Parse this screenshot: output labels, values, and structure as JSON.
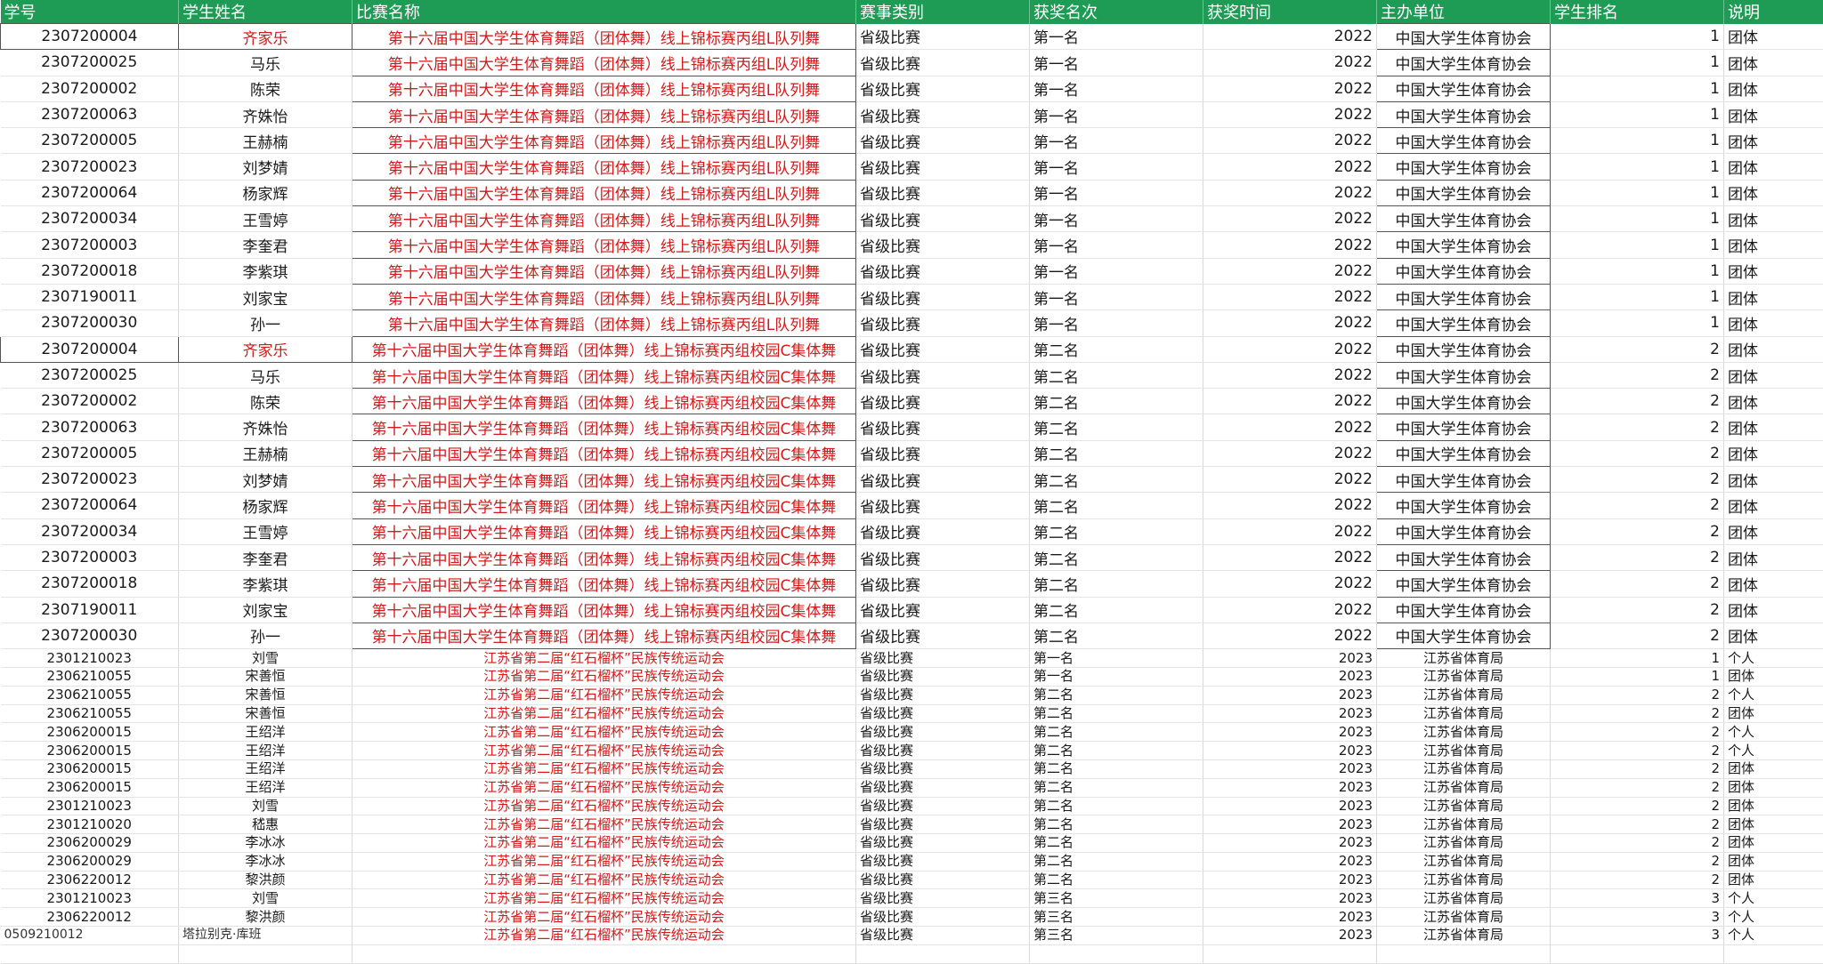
{
  "columns": [
    "学号",
    "学生姓名",
    "比赛名称",
    "赛事类别",
    "获奖名次",
    "获奖时间",
    "主办单位",
    "学生排名",
    "说明"
  ],
  "rows": [
    {
      "id": "2307200004",
      "name": "齐家乐",
      "name_red": true,
      "comp": "第十六届中国大学生体育舞蹈（团体舞）线上锦标赛丙组L队列舞",
      "cat": "省级比赛",
      "rank": "第一名",
      "year": "2022",
      "org": "中国大学生体育协会",
      "srank": "1",
      "note": "团体",
      "size": "big",
      "boxed": true
    },
    {
      "id": "2307200025",
      "name": "马乐",
      "comp": "第十六届中国大学生体育舞蹈（团体舞）线上锦标赛丙组L队列舞",
      "cat": "省级比赛",
      "rank": "第一名",
      "year": "2022",
      "org": "中国大学生体育协会",
      "srank": "1",
      "note": "团体",
      "size": "big"
    },
    {
      "id": "2307200002",
      "name": "陈荣",
      "comp": "第十六届中国大学生体育舞蹈（团体舞）线上锦标赛丙组L队列舞",
      "cat": "省级比赛",
      "rank": "第一名",
      "year": "2022",
      "org": "中国大学生体育协会",
      "srank": "1",
      "note": "团体",
      "size": "big"
    },
    {
      "id": "2307200063",
      "name": "齐姝怡",
      "comp": "第十六届中国大学生体育舞蹈（团体舞）线上锦标赛丙组L队列舞",
      "cat": "省级比赛",
      "rank": "第一名",
      "year": "2022",
      "org": "中国大学生体育协会",
      "srank": "1",
      "note": "团体",
      "size": "big"
    },
    {
      "id": "2307200005",
      "name": "王赫楠",
      "comp": "第十六届中国大学生体育舞蹈（团体舞）线上锦标赛丙组L队列舞",
      "cat": "省级比赛",
      "rank": "第一名",
      "year": "2022",
      "org": "中国大学生体育协会",
      "srank": "1",
      "note": "团体",
      "size": "big"
    },
    {
      "id": "2307200023",
      "name": "刘梦婧",
      "comp": "第十六届中国大学生体育舞蹈（团体舞）线上锦标赛丙组L队列舞",
      "cat": "省级比赛",
      "rank": "第一名",
      "year": "2022",
      "org": "中国大学生体育协会",
      "srank": "1",
      "note": "团体",
      "size": "big"
    },
    {
      "id": "2307200064",
      "name": "杨家辉",
      "comp": "第十六届中国大学生体育舞蹈（团体舞）线上锦标赛丙组L队列舞",
      "cat": "省级比赛",
      "rank": "第一名",
      "year": "2022",
      "org": "中国大学生体育协会",
      "srank": "1",
      "note": "团体",
      "size": "big"
    },
    {
      "id": "2307200034",
      "name": "王雪婷",
      "comp": "第十六届中国大学生体育舞蹈（团体舞）线上锦标赛丙组L队列舞",
      "cat": "省级比赛",
      "rank": "第一名",
      "year": "2022",
      "org": "中国大学生体育协会",
      "srank": "1",
      "note": "团体",
      "size": "big"
    },
    {
      "id": "2307200003",
      "name": "李奎君",
      "comp": "第十六届中国大学生体育舞蹈（团体舞）线上锦标赛丙组L队列舞",
      "cat": "省级比赛",
      "rank": "第一名",
      "year": "2022",
      "org": "中国大学生体育协会",
      "srank": "1",
      "note": "团体",
      "size": "big"
    },
    {
      "id": "2307200018",
      "name": "李紫琪",
      "comp": "第十六届中国大学生体育舞蹈（团体舞）线上锦标赛丙组L队列舞",
      "cat": "省级比赛",
      "rank": "第一名",
      "year": "2022",
      "org": "中国大学生体育协会",
      "srank": "1",
      "note": "团体",
      "size": "big"
    },
    {
      "id": "2307190011",
      "name": "刘家宝",
      "comp": "第十六届中国大学生体育舞蹈（团体舞）线上锦标赛丙组L队列舞",
      "cat": "省级比赛",
      "rank": "第一名",
      "year": "2022",
      "org": "中国大学生体育协会",
      "srank": "1",
      "note": "团体",
      "size": "big"
    },
    {
      "id": "2307200030",
      "name": "孙一",
      "comp": "第十六届中国大学生体育舞蹈（团体舞）线上锦标赛丙组L队列舞",
      "cat": "省级比赛",
      "rank": "第一名",
      "year": "2022",
      "org": "中国大学生体育协会",
      "srank": "1",
      "note": "团体",
      "size": "big"
    },
    {
      "id": "2307200004",
      "name": "齐家乐",
      "name_red": true,
      "comp": "第十六届中国大学生体育舞蹈（团体舞）线上锦标赛丙组校园C集体舞",
      "cat": "省级比赛",
      "rank": "第二名",
      "year": "2022",
      "org": "中国大学生体育协会",
      "srank": "2",
      "note": "团体",
      "size": "big",
      "boxed": true
    },
    {
      "id": "2307200025",
      "name": "马乐",
      "comp": "第十六届中国大学生体育舞蹈（团体舞）线上锦标赛丙组校园C集体舞",
      "cat": "省级比赛",
      "rank": "第二名",
      "year": "2022",
      "org": "中国大学生体育协会",
      "srank": "2",
      "note": "团体",
      "size": "big"
    },
    {
      "id": "2307200002",
      "name": "陈荣",
      "comp": "第十六届中国大学生体育舞蹈（团体舞）线上锦标赛丙组校园C集体舞",
      "cat": "省级比赛",
      "rank": "第二名",
      "year": "2022",
      "org": "中国大学生体育协会",
      "srank": "2",
      "note": "团体",
      "size": "big"
    },
    {
      "id": "2307200063",
      "name": "齐姝怡",
      "comp": "第十六届中国大学生体育舞蹈（团体舞）线上锦标赛丙组校园C集体舞",
      "cat": "省级比赛",
      "rank": "第二名",
      "year": "2022",
      "org": "中国大学生体育协会",
      "srank": "2",
      "note": "团体",
      "size": "big"
    },
    {
      "id": "2307200005",
      "name": "王赫楠",
      "comp": "第十六届中国大学生体育舞蹈（团体舞）线上锦标赛丙组校园C集体舞",
      "cat": "省级比赛",
      "rank": "第二名",
      "year": "2022",
      "org": "中国大学生体育协会",
      "srank": "2",
      "note": "团体",
      "size": "big"
    },
    {
      "id": "2307200023",
      "name": "刘梦婧",
      "comp": "第十六届中国大学生体育舞蹈（团体舞）线上锦标赛丙组校园C集体舞",
      "cat": "省级比赛",
      "rank": "第二名",
      "year": "2022",
      "org": "中国大学生体育协会",
      "srank": "2",
      "note": "团体",
      "size": "big"
    },
    {
      "id": "2307200064",
      "name": "杨家辉",
      "comp": "第十六届中国大学生体育舞蹈（团体舞）线上锦标赛丙组校园C集体舞",
      "cat": "省级比赛",
      "rank": "第二名",
      "year": "2022",
      "org": "中国大学生体育协会",
      "srank": "2",
      "note": "团体",
      "size": "big"
    },
    {
      "id": "2307200034",
      "name": "王雪婷",
      "comp": "第十六届中国大学生体育舞蹈（团体舞）线上锦标赛丙组校园C集体舞",
      "cat": "省级比赛",
      "rank": "第二名",
      "year": "2022",
      "org": "中国大学生体育协会",
      "srank": "2",
      "note": "团体",
      "size": "big"
    },
    {
      "id": "2307200003",
      "name": "李奎君",
      "comp": "第十六届中国大学生体育舞蹈（团体舞）线上锦标赛丙组校园C集体舞",
      "cat": "省级比赛",
      "rank": "第二名",
      "year": "2022",
      "org": "中国大学生体育协会",
      "srank": "2",
      "note": "团体",
      "size": "big"
    },
    {
      "id": "2307200018",
      "name": "李紫琪",
      "comp": "第十六届中国大学生体育舞蹈（团体舞）线上锦标赛丙组校园C集体舞",
      "cat": "省级比赛",
      "rank": "第二名",
      "year": "2022",
      "org": "中国大学生体育协会",
      "srank": "2",
      "note": "团体",
      "size": "big"
    },
    {
      "id": "2307190011",
      "name": "刘家宝",
      "comp": "第十六届中国大学生体育舞蹈（团体舞）线上锦标赛丙组校园C集体舞",
      "cat": "省级比赛",
      "rank": "第二名",
      "year": "2022",
      "org": "中国大学生体育协会",
      "srank": "2",
      "note": "团体",
      "size": "big"
    },
    {
      "id": "2307200030",
      "name": "孙一",
      "comp": "第十六届中国大学生体育舞蹈（团体舞）线上锦标赛丙组校园C集体舞",
      "cat": "省级比赛",
      "rank": "第二名",
      "year": "2022",
      "org": "中国大学生体育协会",
      "srank": "2",
      "note": "团体",
      "size": "big"
    },
    {
      "id": "2301210023",
      "name": "刘雪",
      "comp": "江苏省第二届“红石榴杯”民族传统运动会",
      "cat": "省级比赛",
      "rank": "第一名",
      "year": "2023",
      "org": "江苏省体育局",
      "srank": "1",
      "note": "个人",
      "size": "small"
    },
    {
      "id": "2306210055",
      "name": "宋善恒",
      "comp": "江苏省第二届“红石榴杯”民族传统运动会",
      "cat": "省级比赛",
      "rank": "第一名",
      "year": "2023",
      "org": "江苏省体育局",
      "srank": "1",
      "note": "团体",
      "size": "small"
    },
    {
      "id": "2306210055",
      "name": "宋善恒",
      "comp": "江苏省第二届“红石榴杯”民族传统运动会",
      "cat": "省级比赛",
      "rank": "第二名",
      "year": "2023",
      "org": "江苏省体育局",
      "srank": "2",
      "note": "个人",
      "size": "small"
    },
    {
      "id": "2306210055",
      "name": "宋善恒",
      "comp": "江苏省第二届“红石榴杯”民族传统运动会",
      "cat": "省级比赛",
      "rank": "第二名",
      "year": "2023",
      "org": "江苏省体育局",
      "srank": "2",
      "note": "团体",
      "size": "small"
    },
    {
      "id": "2306200015",
      "name": "王绍洋",
      "comp": "江苏省第二届“红石榴杯”民族传统运动会",
      "cat": "省级比赛",
      "rank": "第二名",
      "year": "2023",
      "org": "江苏省体育局",
      "srank": "2",
      "note": "个人",
      "size": "small"
    },
    {
      "id": "2306200015",
      "name": "王绍洋",
      "comp": "江苏省第二届“红石榴杯”民族传统运动会",
      "cat": "省级比赛",
      "rank": "第二名",
      "year": "2023",
      "org": "江苏省体育局",
      "srank": "2",
      "note": "个人",
      "size": "small"
    },
    {
      "id": "2306200015",
      "name": "王绍洋",
      "comp": "江苏省第二届“红石榴杯”民族传统运动会",
      "cat": "省级比赛",
      "rank": "第二名",
      "year": "2023",
      "org": "江苏省体育局",
      "srank": "2",
      "note": "团体",
      "size": "small"
    },
    {
      "id": "2306200015",
      "name": "王绍洋",
      "comp": "江苏省第二届“红石榴杯”民族传统运动会",
      "cat": "省级比赛",
      "rank": "第二名",
      "year": "2023",
      "org": "江苏省体育局",
      "srank": "2",
      "note": "团体",
      "size": "small"
    },
    {
      "id": "2301210023",
      "name": "刘雪",
      "comp": "江苏省第二届“红石榴杯”民族传统运动会",
      "cat": "省级比赛",
      "rank": "第二名",
      "year": "2023",
      "org": "江苏省体育局",
      "srank": "2",
      "note": "团体",
      "size": "small"
    },
    {
      "id": "2301210020",
      "name": "嵇惠",
      "comp": "江苏省第二届“红石榴杯”民族传统运动会",
      "cat": "省级比赛",
      "rank": "第二名",
      "year": "2023",
      "org": "江苏省体育局",
      "srank": "2",
      "note": "团体",
      "size": "small"
    },
    {
      "id": "2306200029",
      "name": "李冰冰",
      "comp": "江苏省第二届“红石榴杯”民族传统运动会",
      "cat": "省级比赛",
      "rank": "第二名",
      "year": "2023",
      "org": "江苏省体育局",
      "srank": "2",
      "note": "团体",
      "size": "small"
    },
    {
      "id": "2306200029",
      "name": "李冰冰",
      "comp": "江苏省第二届“红石榴杯”民族传统运动会",
      "cat": "省级比赛",
      "rank": "第二名",
      "year": "2023",
      "org": "江苏省体育局",
      "srank": "2",
      "note": "团体",
      "size": "small"
    },
    {
      "id": "2306220012",
      "name": "黎洪颜",
      "comp": "江苏省第二届“红石榴杯”民族传统运动会",
      "cat": "省级比赛",
      "rank": "第二名",
      "year": "2023",
      "org": "江苏省体育局",
      "srank": "2",
      "note": "团体",
      "size": "small"
    },
    {
      "id": "2301210023",
      "name": "刘雪",
      "comp": "江苏省第二届“红石榴杯”民族传统运动会",
      "cat": "省级比赛",
      "rank": "第三名",
      "year": "2023",
      "org": "江苏省体育局",
      "srank": "3",
      "note": "个人",
      "size": "small"
    },
    {
      "id": "2306220012",
      "name": "黎洪颜",
      "comp": "江苏省第二届“红石榴杯”民族传统运动会",
      "cat": "省级比赛",
      "rank": "第三名",
      "year": "2023",
      "org": "江苏省体育局",
      "srank": "3",
      "note": "个人",
      "size": "small"
    },
    {
      "id": "0509210012",
      "name": "塔拉别克·库班",
      "comp": "江苏省第二届“红石榴杯”民族传统运动会",
      "cat": "省级比赛",
      "rank": "第三名",
      "year": "2023",
      "org": "江苏省体育局",
      "srank": "3",
      "note": "个人",
      "size": "small",
      "left_id": true
    }
  ]
}
